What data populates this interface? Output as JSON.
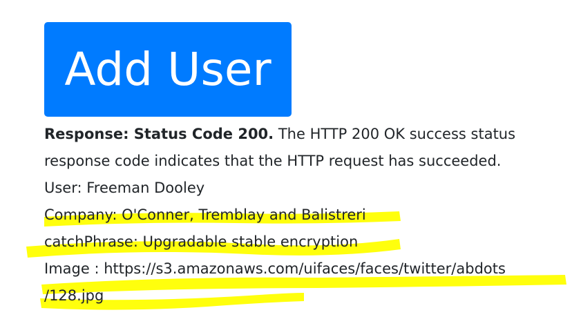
{
  "button": {
    "label": "Add User"
  },
  "response": {
    "status_label": "Response: Status Code 200.",
    "description": " The HTTP 200 OK success status response code indicates that the HTTP request has succeeded."
  },
  "user": {
    "line": "User: Freeman Dooley"
  },
  "company": {
    "line": "Company: O'Conner, Tremblay and Balistreri"
  },
  "catch_phrase": {
    "line": "catchPhrase: Upgradable stable encryption"
  },
  "image": {
    "line_part1": "Image : https://s3.amazonaws.com/uifaces/faces/twitter/abdots",
    "line_part2": "/128.jpg"
  },
  "colors": {
    "button_bg": "#007bff",
    "button_text": "#ffffff",
    "highlighter": "#ffff00",
    "text": "#212529"
  }
}
